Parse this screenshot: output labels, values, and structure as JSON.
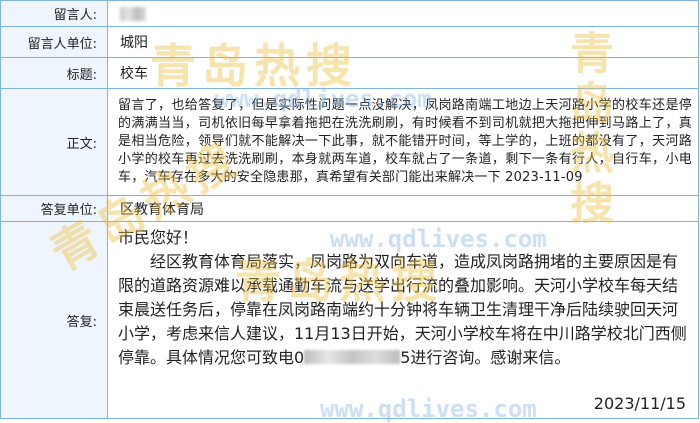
{
  "labels": {
    "author": "留言人:",
    "author_unit": "留言人单位:",
    "title": "标题:",
    "body": "正文:",
    "reply_unit": "答复单位:",
    "reply": "答复:"
  },
  "message": {
    "author_unit": "城阳",
    "title": "校车",
    "body": "留言了，也给答复了，但是实际性问题一点没解决，凤岗路南端工地边上天河路小学的校车还是停的满满当当，司机依旧每早拿着拖把在洗洗刷刷，有时候看不到司机就把大拖把伸到马路上了，真是相当危险，领导们就不能解决一下此事，就不能错开时间，等上学的，上班的都没有了，天河路小学的校车再过去洗洗刷刷，本身就两车道，校车就占了一条道，剩下一条有行人，自行车，小电车，汽车存在多大的安全隐患那，真希望有关部门能出来解决一下  2023-11-09"
  },
  "reply": {
    "unit": "区教育体育局",
    "greeting": "市民您好！",
    "text_before_mask": "经区教育体育局落实，凤岗路为双向车道，造成凤岗路拥堵的主要原因是有限的道路资源难以承载通勤车流与送学出行流的叠加影响。天河小学校车每天结束晨送任务后，停靠在凤岗路南端约十分钟将车辆卫生清理干净后陆续驶回天河小学，考虑来信人建议，11月13日开始，天河小学校车将在中川路学校北门西侧停靠。具体情况您可致电0",
    "text_after_mask": "5进行咨询。感谢来信。",
    "date": "2023/11/15"
  },
  "watermark": {
    "cn_text": "青岛热搜",
    "url_text": "www.qdlives.com",
    "color": "#ECBE3C",
    "url_color": "#78AAE6"
  },
  "colors": {
    "border": "#7fb3e0",
    "label_bg": "#eef5fc"
  }
}
